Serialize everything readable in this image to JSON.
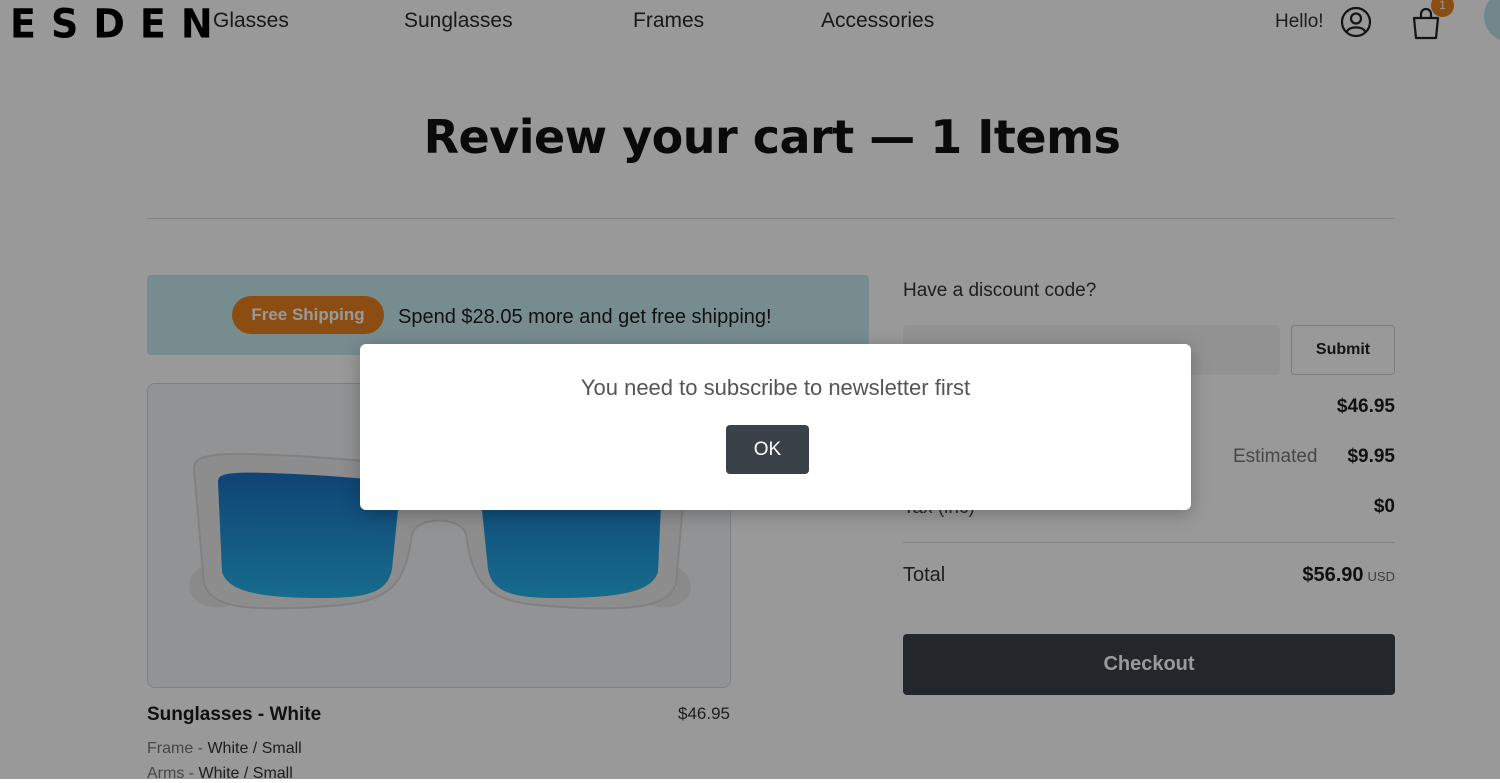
{
  "header": {
    "logo": "ESDEN",
    "nav": [
      "Glasses",
      "Sunglasses",
      "Frames",
      "Accessories"
    ],
    "greeting": "Hello!",
    "cart_count": "1",
    "icons": [
      "user-icon",
      "shopping-bag-icon",
      "chat-icon"
    ]
  },
  "page": {
    "title": "Review your cart — 1 Items"
  },
  "shipping_banner": {
    "pill": "Free Shipping",
    "message": "Spend $28.05 more and get free shipping!",
    "banner_color": "#c7eaef",
    "pill_color": "#e8811d"
  },
  "product": {
    "name": "Sunglasses - White",
    "price": "$46.95",
    "specs": [
      {
        "label": "Frame",
        "value": "White / Small"
      },
      {
        "label": "Arms",
        "value": "White / Small"
      }
    ],
    "lens_color": "#1a8fd6"
  },
  "summary": {
    "discount_label": "Have a discount code?",
    "discount_placeholder": "",
    "submit_label": "Submit",
    "subtotal_value": "$46.95",
    "shipping_estimate": "Estimated",
    "shipping_value": "$9.95",
    "tax_label": "Tax (inc)",
    "tax_value": "$0",
    "total_label": "Total",
    "total_value": "$56.90",
    "total_currency": "USD",
    "checkout_label": "Checkout"
  },
  "dialog": {
    "message": "You need to subscribe to newsletter first",
    "ok_label": "OK"
  },
  "colors": {
    "accent": "#e8811d",
    "dark_button": "#3b4148"
  }
}
